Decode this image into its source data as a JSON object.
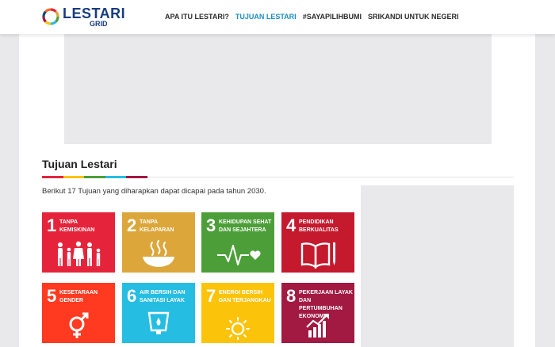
{
  "header": {
    "logo_text": "LESTARI",
    "logo_sub": "GRID",
    "nav": [
      {
        "label": "APA ITU LESTARI?",
        "active": false
      },
      {
        "label": "TUJUAN LESTARI",
        "active": true
      },
      {
        "label": "#SAYAPILIHBUMI",
        "active": false
      },
      {
        "label": "SRIKANDI UNTUK NEGERI",
        "active": false
      }
    ]
  },
  "section": {
    "title": "Tujuan Lestari",
    "intro": "Berikut 17 Tujuan yang diharapkan dapat dicapai pada tahun 2030."
  },
  "colors": {
    "accent_bar": [
      "#e5243b",
      "#fcc30b",
      "#4c9f38",
      "#26bde2",
      "#a21942"
    ]
  },
  "goals": [
    {
      "number": "1",
      "label": "TANPA KEMISKINAN",
      "color": "#e5243b",
      "icon": "family-icon"
    },
    {
      "number": "2",
      "label": "TANPA KELAPARAN",
      "color": "#dda63a",
      "icon": "bowl-icon"
    },
    {
      "number": "3",
      "label": "KEHIDUPAN SEHAT DAN SEJAHTERA",
      "color": "#4c9f38",
      "icon": "heartbeat-icon"
    },
    {
      "number": "4",
      "label": "PENDIDIKAN BERKUALITAS",
      "color": "#c5192d",
      "icon": "book-icon"
    },
    {
      "number": "5",
      "label": "KESETARAAN GENDER",
      "color": "#ff3a21",
      "icon": "gender-icon"
    },
    {
      "number": "6",
      "label": "AIR BERSIH DAN SANITASI LAYAK",
      "color": "#26bde2",
      "icon": "water-icon"
    },
    {
      "number": "7",
      "label": "ENERGI BERSIH DAN TERJANGKAU",
      "color": "#fcc30b",
      "icon": "sun-icon"
    },
    {
      "number": "8",
      "label": "PEKERJAAN LAYAK DAN PERTUMBUHAN EKONOMI",
      "color": "#a21942",
      "icon": "growth-chart-icon"
    }
  ]
}
